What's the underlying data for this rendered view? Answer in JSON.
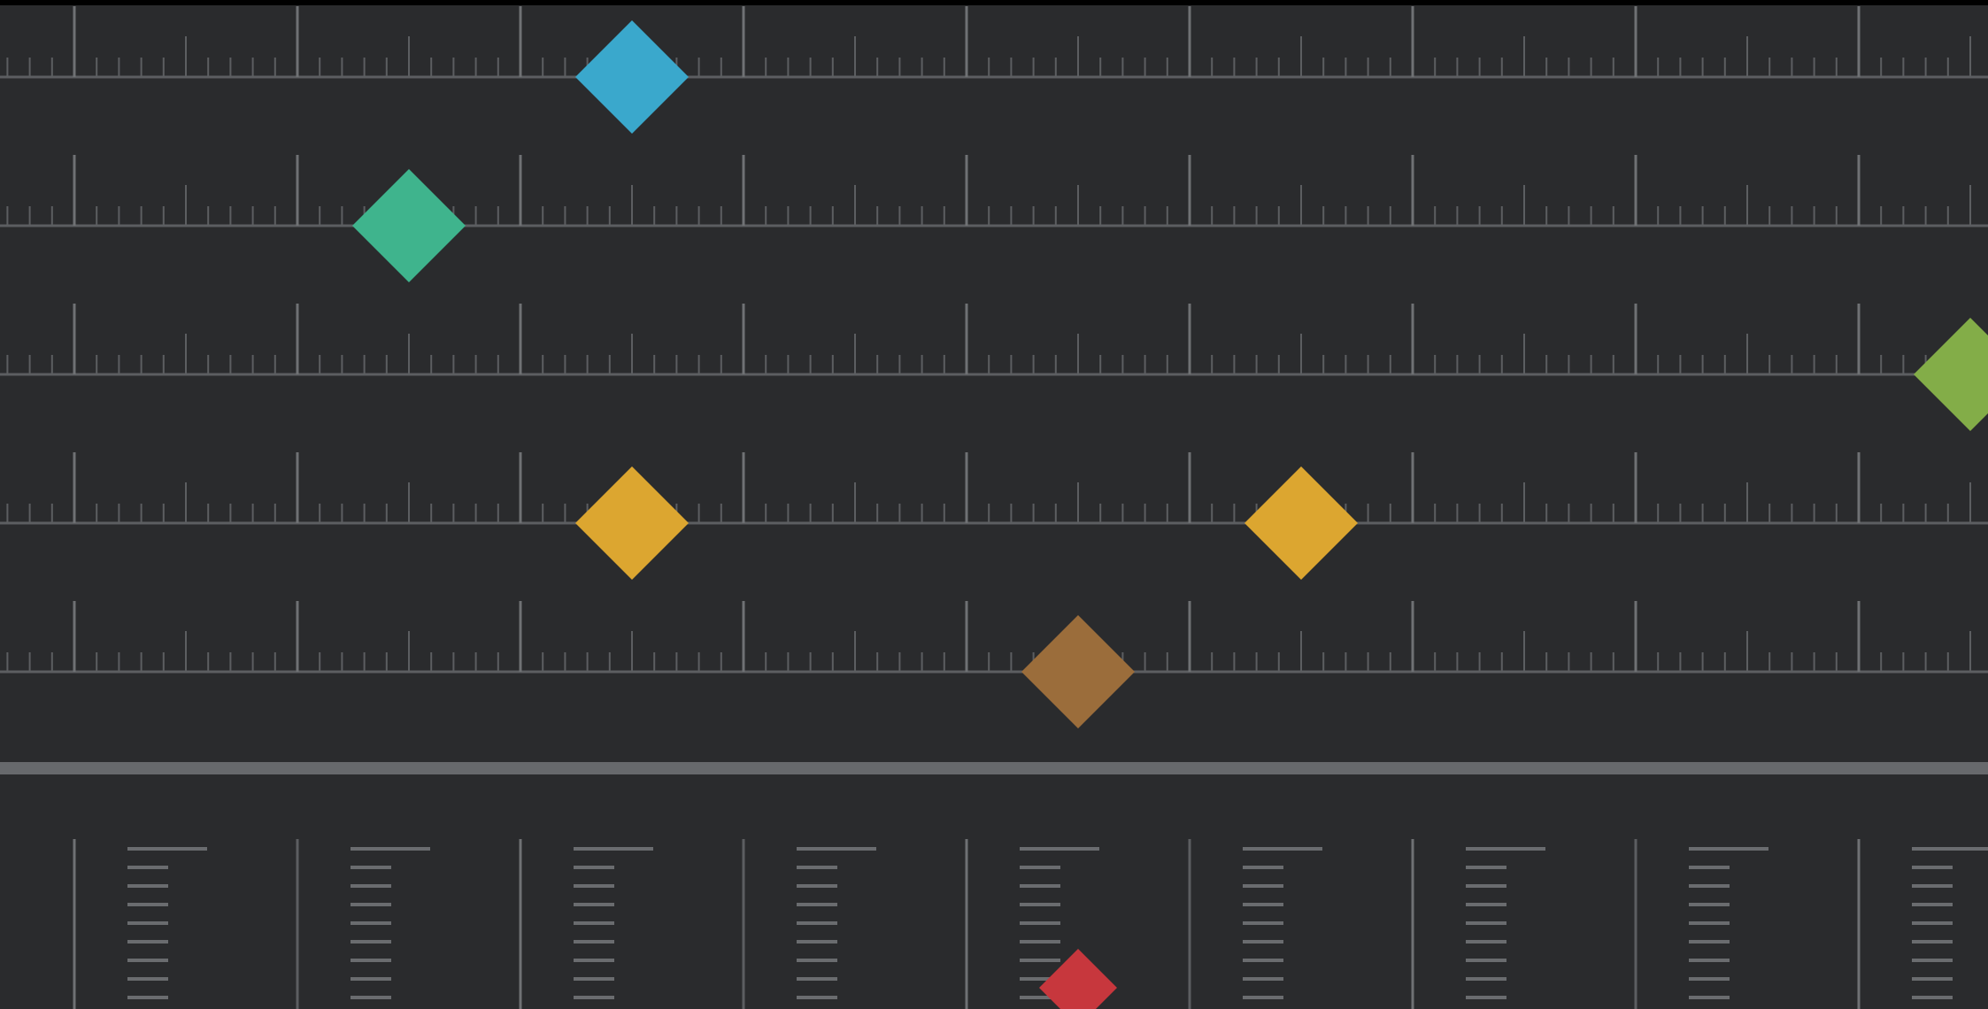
{
  "tracks": [
    {
      "keyframes": [
        {
          "beat": 2.5,
          "color": "#3aa8cc"
        }
      ]
    },
    {
      "keyframes": [
        {
          "beat": 1.5,
          "color": "#3fb48d"
        }
      ]
    },
    {
      "keyframes": [
        {
          "beat": 8.5,
          "color": "#83ad48"
        }
      ]
    },
    {
      "keyframes": [
        {
          "beat": 2.5,
          "color": "#dca630"
        },
        {
          "beat": 5.5,
          "color": "#dca630"
        }
      ]
    },
    {
      "keyframes": [
        {
          "beat": 4.5,
          "color": "#9b6d3b"
        }
      ]
    }
  ],
  "bottom_lane": {
    "keyframes": [
      {
        "beat": 4.5,
        "color": "#c7373d"
      }
    ]
  },
  "theme": {
    "background": "#2a2b2d",
    "window_border": "#000000",
    "tick_color": "#5c5e61",
    "major_tick_color": "#6f7174",
    "separator_color": "#67696c",
    "level_bar_color": "#6a6c6f"
  }
}
